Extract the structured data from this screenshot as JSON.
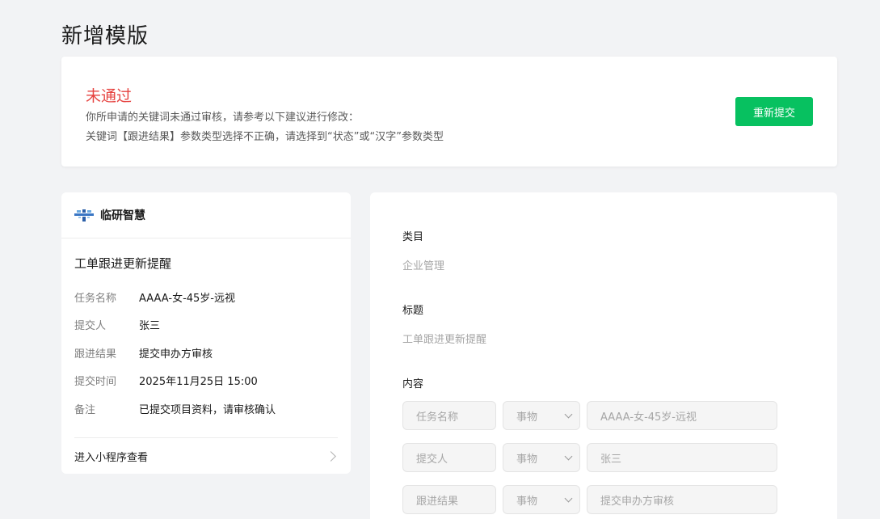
{
  "page": {
    "title": "新增模版"
  },
  "review": {
    "status": "未通过",
    "line1": "你所申请的关键词未通过审核，请参考以下建议进行修改：",
    "line2": "关键词【跟进结果】参数类型选择不正确，请选择到“状态”或“汉字”参数类型",
    "resubmit_label": "重新提交",
    "status_color": "#e64340",
    "button_color": "#07c160"
  },
  "preview": {
    "app_name": "临研智慧",
    "logo_icon": "app-logo-icon",
    "message_title": "工单跟进更新提醒",
    "fields": [
      {
        "key": "任务名称",
        "value": "AAAA-女-45岁-远视"
      },
      {
        "key": "提交人",
        "value": "张三"
      },
      {
        "key": "跟进结果",
        "value": "提交申办方审核"
      },
      {
        "key": "提交时间",
        "value": "2025年11月25日 15:00"
      },
      {
        "key": "备注",
        "value": "已提交项目资料，请审核确认"
      }
    ],
    "footer_label": "进入小程序查看",
    "footer_icon": "chevron-right-icon"
  },
  "form": {
    "category_label": "类目",
    "category_value": "企业管理",
    "title_label": "标题",
    "title_value": "工单跟进更新提醒",
    "content_label": "内容",
    "params": [
      {
        "key": "任务名称",
        "type": "事物",
        "value": "AAAA-女-45岁-远视"
      },
      {
        "key": "提交人",
        "type": "事物",
        "value": "张三"
      },
      {
        "key": "跟进结果",
        "type": "事物",
        "value": "提交申办方审核"
      }
    ]
  }
}
